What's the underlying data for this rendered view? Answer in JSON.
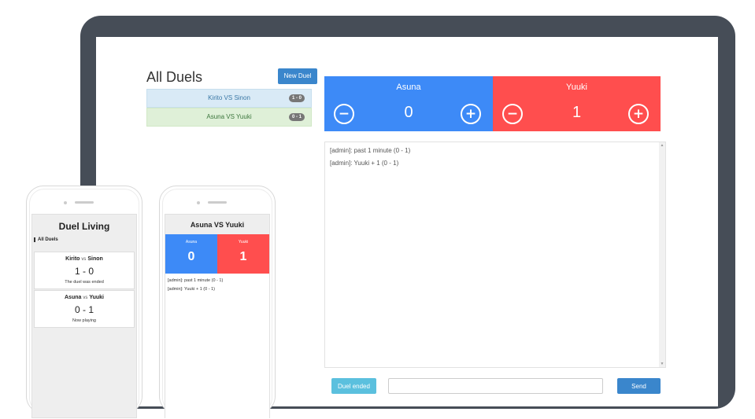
{
  "desktop": {
    "title": "All Duels",
    "new_duel_label": "New Duel",
    "duels": [
      {
        "label": "Kirito VS Sinon",
        "score": "1 - 0"
      },
      {
        "label": "Asuna VS Yuuki",
        "score": "0 - 1"
      }
    ],
    "scoreboard": {
      "left": {
        "name": "Asuna",
        "score": "0"
      },
      "right": {
        "name": "Yuuki",
        "score": "1"
      },
      "minus_glyph": "−",
      "plus_glyph": "+"
    },
    "chat": [
      "[admin]: past 1 minute (0 - 1)",
      "[admin]: Yuuki + 1 (0 - 1)"
    ],
    "duel_ended_label": "Duel ended",
    "message_value": "",
    "send_label": "Send"
  },
  "phone1": {
    "title": "Duel Living",
    "subtitle": "All Duels",
    "vs": "vs",
    "cards": [
      {
        "p1": "Kirito",
        "p2": "Sinon",
        "score": "1 - 0",
        "status": "The duel was ended"
      },
      {
        "p1": "Asuna",
        "p2": "Yuuki",
        "score": "0 - 1",
        "status": "Now playing"
      }
    ]
  },
  "phone2": {
    "title": "Asuna VS Yuuki",
    "left": {
      "name": "Asuna",
      "score": "0"
    },
    "right": {
      "name": "Yuuki",
      "score": "1"
    },
    "chat": [
      "[admin]: past 1 minute (0 - 1)",
      "[admin]: Yuuki + 1 (0 - 1)"
    ]
  },
  "colors": {
    "blue_team": "#3d8af7",
    "red_team": "#ff4e4e",
    "primary_button": "#3a86cc",
    "info_button": "#5bc0de",
    "laptop_frame": "#464d57"
  }
}
